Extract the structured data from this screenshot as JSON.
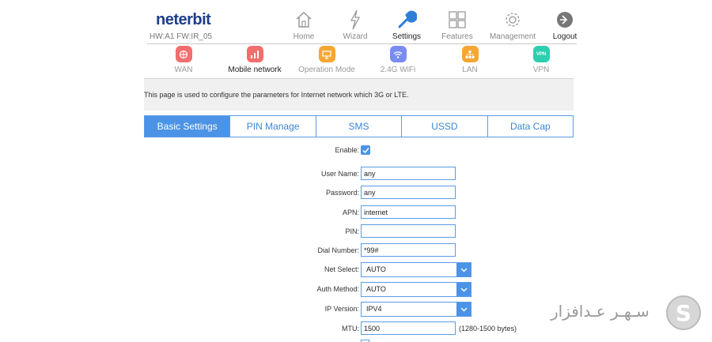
{
  "header": {
    "logo": "neterbit",
    "firmware": "HW:A1 FW:IR_05",
    "nav": [
      {
        "label": "Home",
        "icon": "house-icon"
      },
      {
        "label": "Wizard",
        "icon": "lightning-icon"
      },
      {
        "label": "Settings",
        "icon": "wrench-icon",
        "active": true
      },
      {
        "label": "Features",
        "icon": "grid-icon"
      },
      {
        "label": "Management",
        "icon": "gear-icon"
      },
      {
        "label": "Logout",
        "icon": "exit-icon"
      }
    ]
  },
  "subnav": [
    {
      "label": "WAN",
      "color": "#f06e6e"
    },
    {
      "label": "Mobile network",
      "color": "#f06e6e",
      "active": true
    },
    {
      "label": "Operation Mode",
      "color": "#f5a732"
    },
    {
      "label": "2.4G WiFi",
      "color": "#7b8cf0"
    },
    {
      "label": "LAN",
      "color": "#f5a732"
    },
    {
      "label": "VPN",
      "color": "#2ccfb0",
      "icon_text": "VPN"
    }
  ],
  "info_text": "This page is used to configure the parameters for Internet network which 3G or LTE.",
  "tabs": [
    "Basic Settings",
    "PIN Manage",
    "SMS",
    "USSD",
    "Data Cap"
  ],
  "form": {
    "enable_label": "Enable:",
    "enable_checked": true,
    "username": {
      "label": "User Name:",
      "value": "any"
    },
    "password": {
      "label": "Password:",
      "value": "any"
    },
    "apn": {
      "label": "APN:",
      "value": "internet"
    },
    "pin": {
      "label": "PIN:",
      "value": ""
    },
    "dial": {
      "label": "Dial Number:",
      "value": "*99#"
    },
    "net_select": {
      "label": "Net Select:",
      "value": "AUTO"
    },
    "auth_method": {
      "label": "Auth Method:",
      "value": "AUTO"
    },
    "ip_version": {
      "label": "IP Version:",
      "value": "IPV4"
    },
    "mtu": {
      "label": "MTU:",
      "value": "1500",
      "hint": "(1280-1500 bytes)"
    }
  },
  "watermark": {
    "text": "سـهـر عـدافزار",
    "letter": "S"
  },
  "colors": {
    "accent": "#4b93e6",
    "brand": "#1c3d8a"
  }
}
